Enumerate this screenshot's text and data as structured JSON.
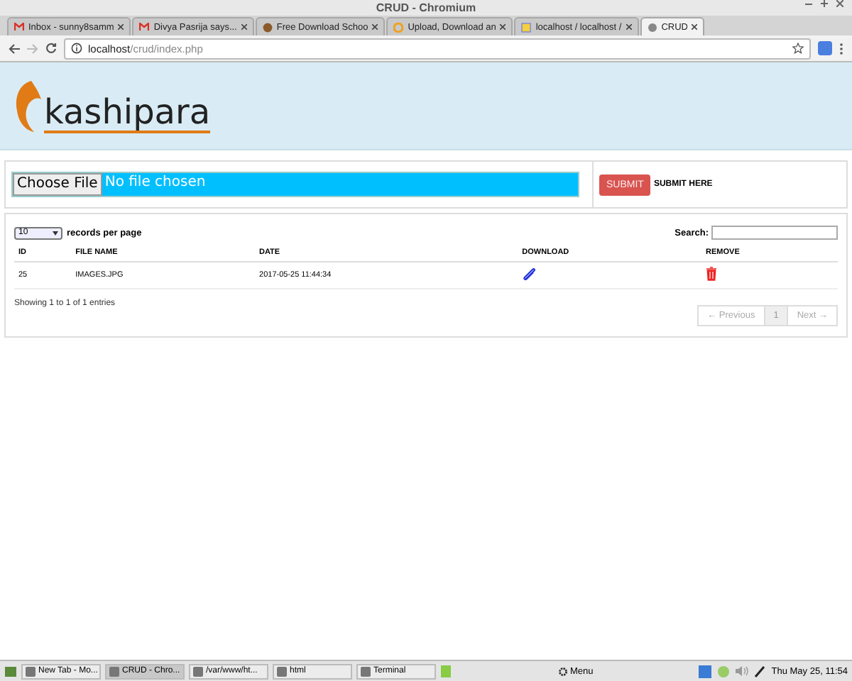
{
  "window": {
    "title": "CRUD - Chromium"
  },
  "tabs": [
    {
      "label": "Inbox - sunny8samm",
      "selected": false
    },
    {
      "label": "Divya Pasrija says...",
      "selected": false
    },
    {
      "label": "Free Download Schoo",
      "selected": false
    },
    {
      "label": "Upload, Download an",
      "selected": false
    },
    {
      "label": "localhost / localhost /",
      "selected": false
    },
    {
      "label": "CRUD",
      "selected": true
    }
  ],
  "address_bar": {
    "host": "localhost",
    "path": "/crud/index.php"
  },
  "logo": {
    "text": "kashipara"
  },
  "upload": {
    "choose_button": "Choose File",
    "status": "No file chosen",
    "submit_button": "SUBMIT",
    "submit_label": "SUBMIT HERE"
  },
  "table": {
    "page_size": "10",
    "page_size_label": "records per page",
    "search_label": "Search:",
    "columns": [
      "ID",
      "FILE NAME",
      "DATE",
      "DOWNLOAD",
      "REMOVE"
    ],
    "rows": [
      {
        "id": "25",
        "file_name": "IMAGES.JPG",
        "date": "2017-05-25 11:44:34"
      }
    ],
    "info": "Showing 1 to 1 of 1 entries",
    "pagination": {
      "previous": {
        "label": "← Previous",
        "disabled": true
      },
      "pages": [
        {
          "label": "1",
          "selected": true
        }
      ],
      "next": {
        "label": "Next →",
        "disabled": true
      }
    }
  },
  "taskbar": {
    "items": [
      {
        "label": "New Tab - Mo...",
        "selected": false
      },
      {
        "label": "CRUD - Chro...",
        "selected": true
      },
      {
        "label": "/var/www/ht...",
        "selected": false
      },
      {
        "label": "html",
        "selected": false
      },
      {
        "label": "Terminal",
        "selected": false
      }
    ],
    "menu": "Menu",
    "clock": "Thu May 25, 11:54"
  }
}
